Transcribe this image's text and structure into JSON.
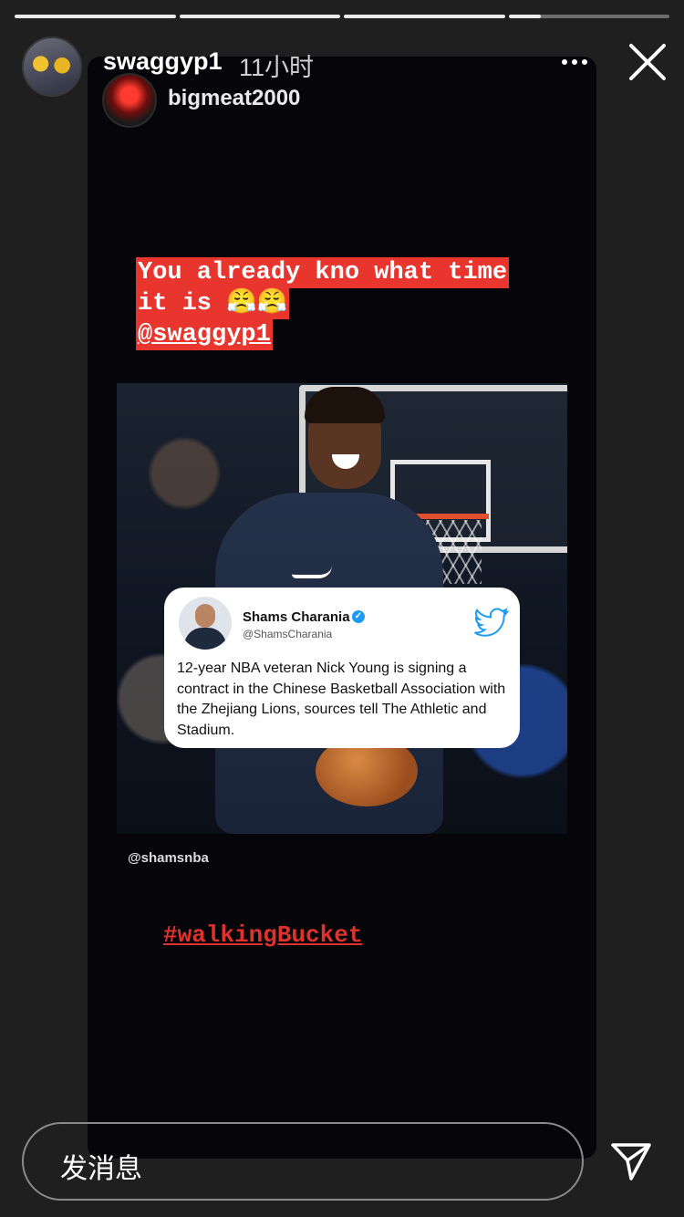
{
  "story": {
    "progress": [
      1,
      1,
      1,
      0.2
    ],
    "username": "swaggyp1",
    "time_ago": "11小时",
    "more_icon": "more-horizontal-icon",
    "close_icon": "close-icon"
  },
  "shared_post": {
    "username": "bigmeat2000",
    "caption_lines": [
      "You already kno what time",
      "it is 😤😤"
    ],
    "mention": "@swaggyp1",
    "tweet": {
      "name": "Shams Charania",
      "handle": "@ShamsCharania",
      "verified_mark": "✓",
      "text": "12-year NBA veteran Nick Young is signing a contract in the Chinese Basketball Association with the Zhejiang Lions, sources tell The Athletic and Stadium."
    },
    "image_credit": "@shamsnba",
    "hashtag": "#walkingBucket"
  },
  "reply": {
    "placeholder": "发消息",
    "send_icon": "send-icon"
  }
}
